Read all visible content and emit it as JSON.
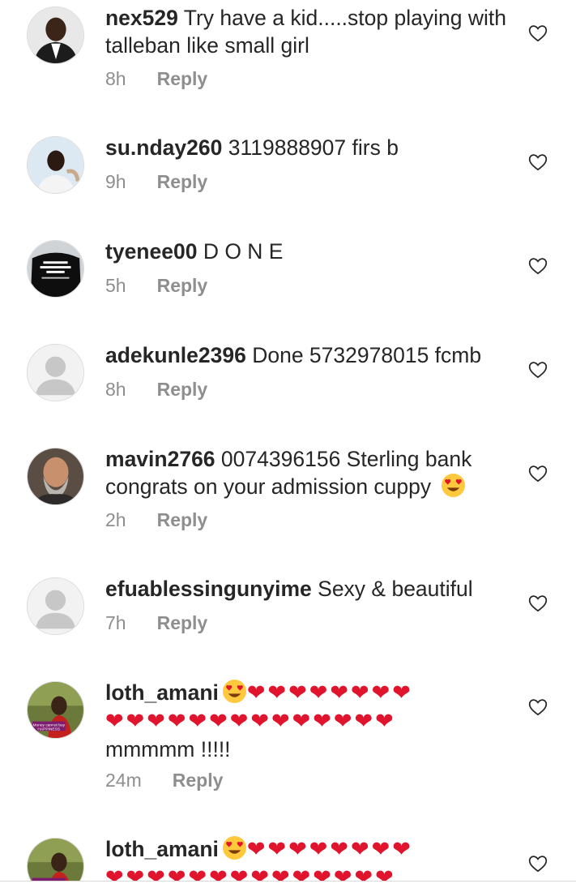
{
  "comments": [
    {
      "username": "nex529",
      "text": "Try have a kid.....stop playing with talleban like small girl",
      "time": "8h",
      "reply_label": "Reply",
      "avatar_icon": "user-photo"
    },
    {
      "username": "su.nday260",
      "text": "3119888907 firs b",
      "time": "9h",
      "reply_label": "Reply",
      "avatar_icon": "user-photo"
    },
    {
      "username": "tyenee00",
      "text": "D O N E",
      "time": "5h",
      "reply_label": "Reply",
      "avatar_icon": "user-photo-tshirt"
    },
    {
      "username": "adekunle2396",
      "text": "Done 5732978015 fcmb",
      "time": "8h",
      "reply_label": "Reply",
      "avatar_icon": "default-avatar"
    },
    {
      "username": "mavin2766",
      "text": "0074396156 Sterling bank congrats on your admission cuppy",
      "time": "2h",
      "reply_label": "Reply",
      "avatar_icon": "user-photo"
    },
    {
      "username": "efuablessingunyime",
      "text": "Sexy & beautiful",
      "time": "7h",
      "reply_label": "Reply",
      "avatar_icon": "default-avatar"
    },
    {
      "username": "loth_amani",
      "text_line1": "❤❤❤❤❤❤❤❤",
      "text_line2": "❤❤❤❤❤❤❤❤❤❤❤❤❤❤",
      "text_line3": "mmmmm !!!!!",
      "time": "24m",
      "reply_label": "Reply",
      "avatar_icon": "user-photo",
      "avatar_caption": "Money cannot buy HAPPINESS"
    },
    {
      "username": "loth_amani",
      "text_line1": "❤❤❤❤❤❤❤❤",
      "text_line2": "❤❤❤❤❤❤❤❤❤❤❤❤❤❤",
      "avatar_icon": "user-photo"
    }
  ],
  "icons": {
    "like": "heart-outline-icon",
    "emoji": "heart-eyes-emoji"
  },
  "colors": {
    "text": "#262626",
    "meta": "#8e8e8e",
    "heart": "#e0152d"
  }
}
